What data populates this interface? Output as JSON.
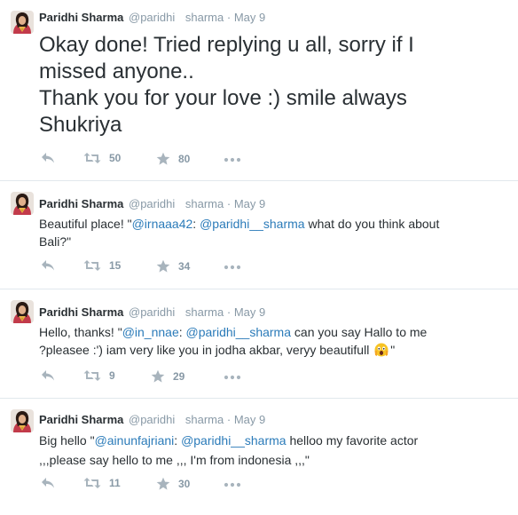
{
  "tweets": [
    {
      "name": "Paridhi Sharma",
      "handle": "@paridhi",
      "handle_suffix": "sharma",
      "dot": "·",
      "date": "May 9",
      "text_lines": [
        "Okay done! Tried replying u all, sorry if I",
        "missed anyone..",
        "Thank you for your love :) smile always",
        "Shukriya"
      ],
      "retweets": "50",
      "favorites": "80"
    },
    {
      "name": "Paridhi Sharma",
      "handle": "@paridhi",
      "handle_suffix": "sharma",
      "dot": "·",
      "date": "May 9",
      "parts": {
        "pre": "Beautiful place! \"",
        "m1": "@irnaaa42",
        "mid": ": ",
        "m2": "@paridhi__sharma",
        "post": " what do you think about",
        "line2": "Bali?\""
      },
      "retweets": "15",
      "favorites": "34"
    },
    {
      "name": "Paridhi Sharma",
      "handle": "@paridhi",
      "handle_suffix": "sharma",
      "dot": "·",
      "date": "May 9",
      "parts": {
        "pre": "Hello, thanks! \"",
        "m1": "@in_nnae",
        "mid": ": ",
        "m2": "@paridhi__sharma",
        "post": " can you say Hallo to me",
        "line2": "?pleasee :') iam very like you in jodha akbar, veryy beautifull",
        "line2_end": "\""
      },
      "retweets": "9",
      "favorites": "29"
    },
    {
      "name": "Paridhi Sharma",
      "handle": "@paridhi",
      "handle_suffix": "sharma",
      "dot": "·",
      "date": "May 9",
      "parts": {
        "pre": "Big hello \"",
        "m1": "@ainunfajriani",
        "mid": ": ",
        "m2": "@paridhi__sharma",
        "post": " helloo my favorite actor",
        "line2": ",,,please say hello to me ,,, I'm from indonesia ,,,\""
      },
      "retweets": "11",
      "favorites": "30"
    }
  ],
  "icons": {
    "reply": "reply-arrow-icon",
    "retweet": "retweet-icon",
    "favorite": "star-icon",
    "more": "more-dots-icon",
    "avatar": "avatar-photo"
  },
  "colors": {
    "mention": "#2b7bb9",
    "meta": "#8899a6",
    "text": "#292f33",
    "divider": "#e1e8ed"
  }
}
